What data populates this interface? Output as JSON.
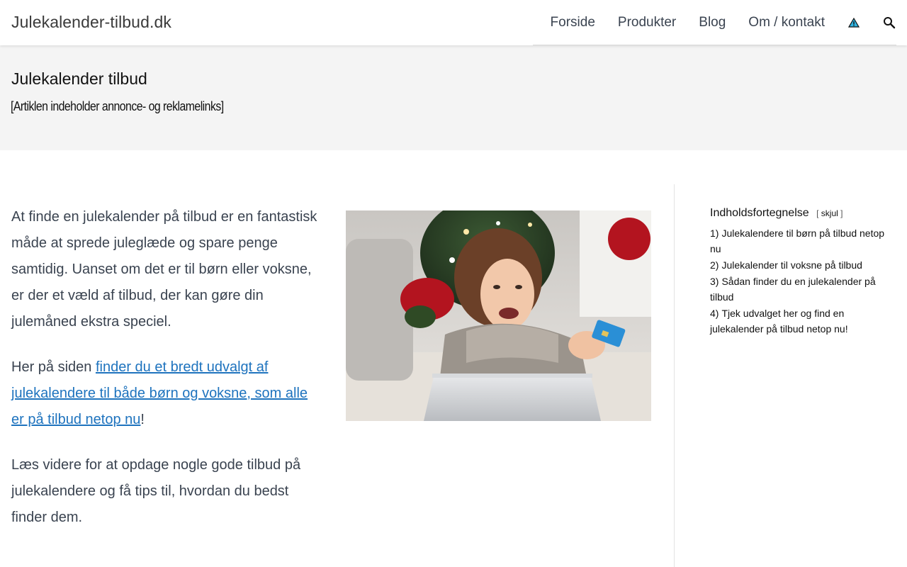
{
  "header": {
    "site_title": "Julekalender-tilbud.dk",
    "nav": [
      {
        "label": "Forside"
      },
      {
        "label": "Produkter"
      },
      {
        "label": "Blog"
      },
      {
        "label": "Om / kontakt"
      }
    ],
    "icons": [
      "warning-triangle-icon",
      "search-icon"
    ]
  },
  "hero": {
    "title": "Julekalender tilbud",
    "disclaimer": "[Artiklen indeholder annonce- og reklamelinks]"
  },
  "main": {
    "paragraph1": "At finde en julekalender på tilbud er en fantastisk måde at sprede juleglæde og spare penge samtidig. Uanset om det er til børn eller voksne, er der et væld af tilbud, der kan gøre din julemåned ekstra speciel.",
    "paragraph2_prefix": "Her på siden ",
    "paragraph2_link": "finder du et bredt udvalgt af julekalendere til både børn og voksne, som alle er på tilbud netop nu",
    "paragraph2_suffix": "!",
    "paragraph3": "Læs videre for at opdage nogle gode tilbud på julekalendere og få tips til, hvordan du bedst finder dem."
  },
  "toc": {
    "title": "Indholdsfortegnelse",
    "toggle_open": "[",
    "toggle_label": "skjul",
    "toggle_close": "]",
    "items": [
      {
        "num": "1)",
        "label": "Julekalendere til børn på tilbud netop nu"
      },
      {
        "num": "2)",
        "label": "Julekalender til voksne på tilbud"
      },
      {
        "num": "3)",
        "label": "Sådan finder du en julekalender på tilbud"
      },
      {
        "num": "4)",
        "label": "Tjek udvalget her og find en julekalender på tilbud netop nu!"
      }
    ]
  },
  "colors": {
    "link": "#1e73be",
    "hero_bg": "#f4f4f4",
    "text": "#3a4350"
  }
}
